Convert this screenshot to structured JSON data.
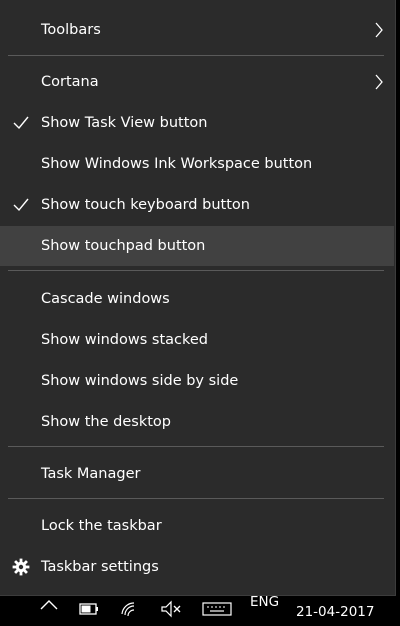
{
  "menu": {
    "items": [
      {
        "label": "Toolbars"
      },
      {
        "label": "Cortana"
      },
      {
        "label": "Show Task View button"
      },
      {
        "label": "Show Windows Ink Workspace button"
      },
      {
        "label": "Show touch keyboard button"
      },
      {
        "label": "Show touchpad button"
      },
      {
        "label": "Cascade windows"
      },
      {
        "label": "Show windows stacked"
      },
      {
        "label": "Show windows side by side"
      },
      {
        "label": "Show the desktop"
      },
      {
        "label": "Task Manager"
      },
      {
        "label": "Lock the taskbar"
      },
      {
        "label": "Taskbar settings"
      }
    ]
  },
  "taskbar": {
    "language": "ENG",
    "date": "21-04-2017"
  }
}
